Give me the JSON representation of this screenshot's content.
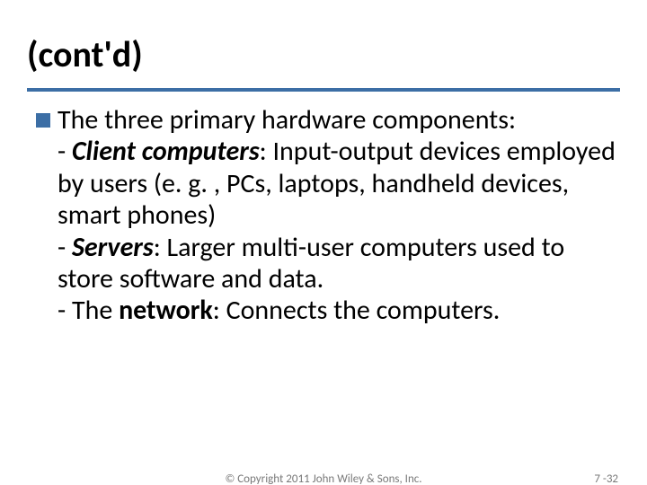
{
  "title": "(cont'd)",
  "body": {
    "lead": "The three primary hardware components:",
    "items": [
      {
        "prefix": " - ",
        "term": "Client computers",
        "rest": ": Input-output devices employed by users (e. g. , PCs, laptops, handheld devices, smart phones)"
      },
      {
        "prefix": " - ",
        "term": "Servers",
        "rest": ": Larger multi-user computers used to store software and data."
      },
      {
        "prefix": " - The ",
        "term": "network",
        "rest": ": Connects the computers."
      }
    ]
  },
  "footer": {
    "copyright": "© Copyright 2011 John Wiley & Sons, Inc.",
    "page": "7 -32"
  }
}
